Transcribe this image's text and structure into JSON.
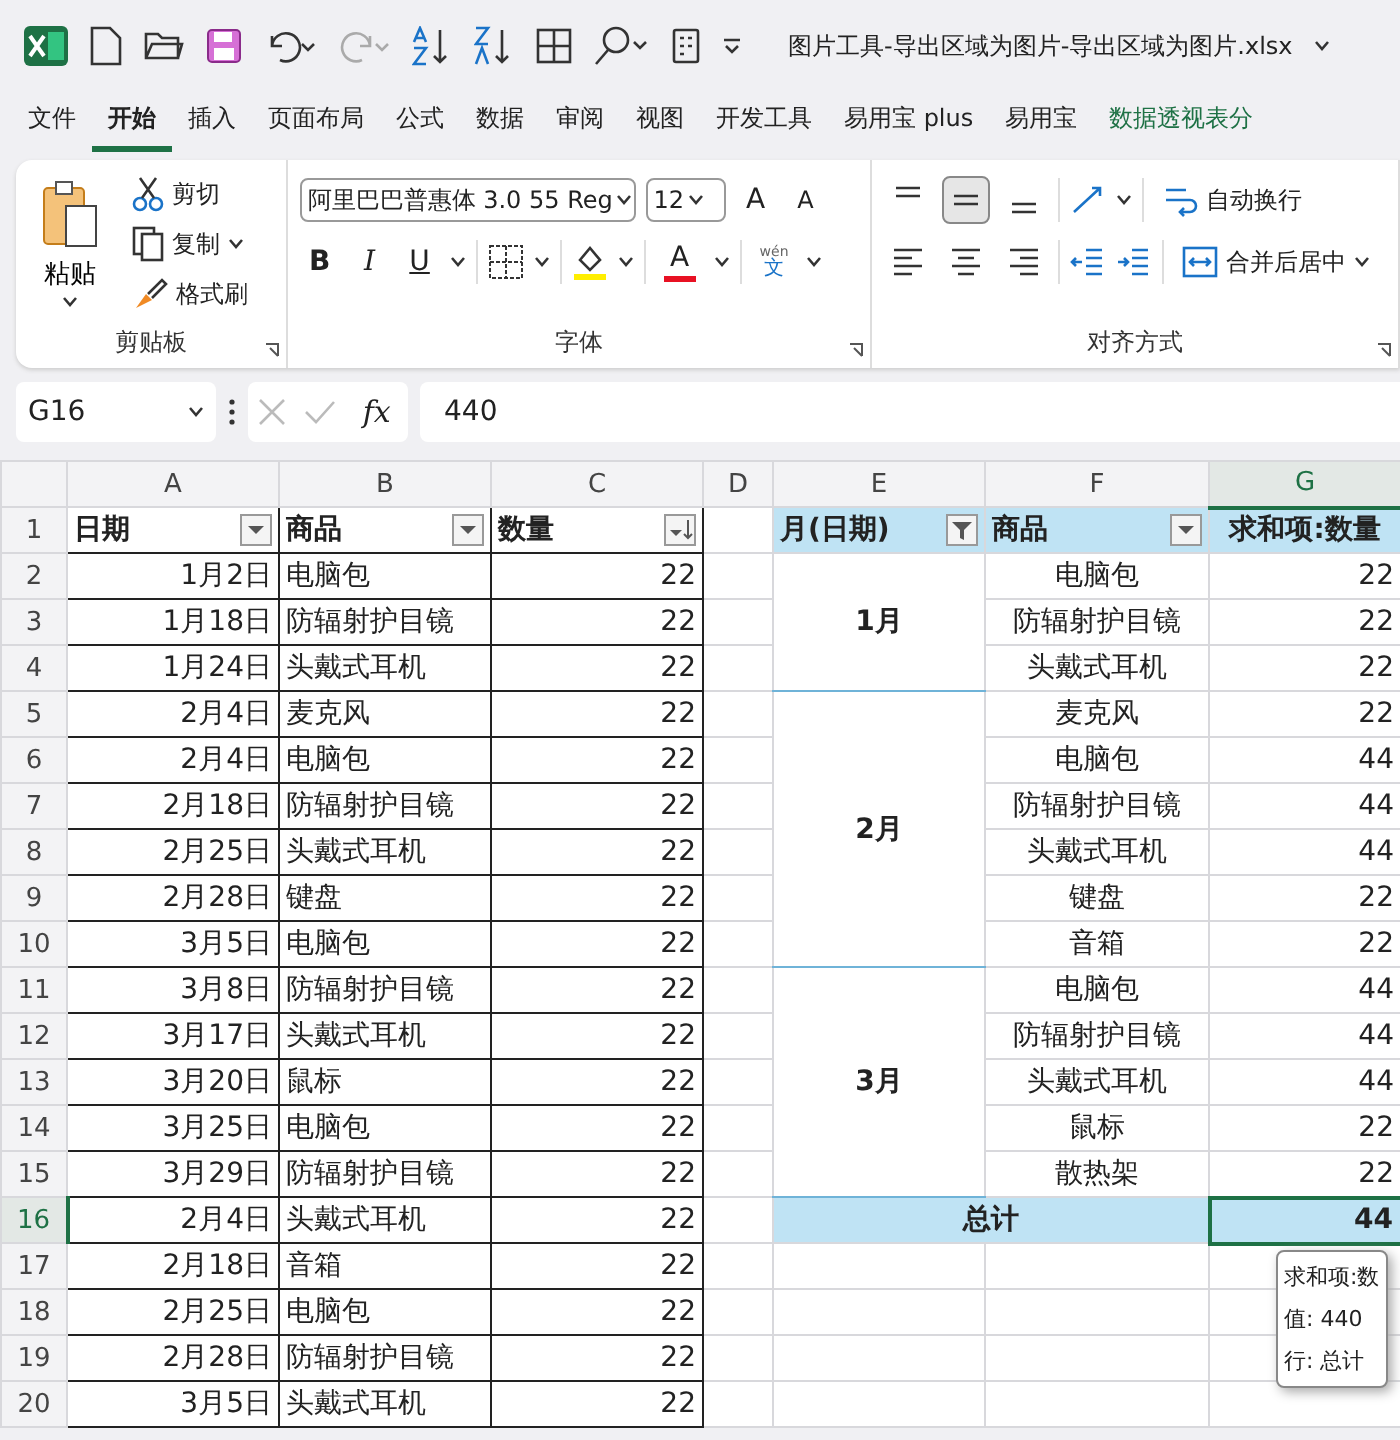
{
  "title_bar": {
    "title": "图片工具-导出区域为图片-导出区域为图片.xlsx"
  },
  "menu_tabs": [
    {
      "label": "文件",
      "selected": false,
      "contextual": false
    },
    {
      "label": "开始",
      "selected": true,
      "contextual": false
    },
    {
      "label": "插入",
      "selected": false,
      "contextual": false
    },
    {
      "label": "页面布局",
      "selected": false,
      "contextual": false
    },
    {
      "label": "公式",
      "selected": false,
      "contextual": false
    },
    {
      "label": "数据",
      "selected": false,
      "contextual": false
    },
    {
      "label": "审阅",
      "selected": false,
      "contextual": false
    },
    {
      "label": "视图",
      "selected": false,
      "contextual": false
    },
    {
      "label": "开发工具",
      "selected": false,
      "contextual": false
    },
    {
      "label": "易用宝 plus",
      "selected": false,
      "contextual": false
    },
    {
      "label": "易用宝",
      "selected": false,
      "contextual": false
    },
    {
      "label": "数据透视表分",
      "selected": false,
      "contextual": true
    }
  ],
  "ribbon": {
    "clipboard": {
      "paste": "粘贴",
      "cut": "剪切",
      "copy": "复制",
      "format_painter": "格式刷",
      "group_label": "剪贴板"
    },
    "font": {
      "font_name": "阿里巴巴普惠体 3.0 55 Reg",
      "font_size": "12",
      "grow_font": "A",
      "shrink_font": "A",
      "bold": "B",
      "italic": "I",
      "underline": "U",
      "font_color": "A",
      "phonetic_top": "wén",
      "phonetic_bottom": "文",
      "group_label": "字体"
    },
    "alignment": {
      "vertical": [
        {
          "kind": "top",
          "selected": false
        },
        {
          "kind": "middle",
          "selected": true
        },
        {
          "kind": "bottom",
          "selected": false
        }
      ],
      "horizontal": [
        {
          "kind": "left",
          "selected": false
        },
        {
          "kind": "center",
          "selected": false
        },
        {
          "kind": "right",
          "selected": false
        }
      ],
      "wrap_text": "自动换行",
      "merge_center": "合并后居中",
      "group_label": "对齐方式"
    }
  },
  "formula_bar": {
    "name_box": "G16",
    "fx": "fx",
    "formula": "440"
  },
  "sheet": {
    "columns": [
      {
        "label": "A",
        "selected": false
      },
      {
        "label": "B",
        "selected": false
      },
      {
        "label": "C",
        "selected": false
      },
      {
        "label": "D",
        "selected": false
      },
      {
        "label": "E",
        "selected": false
      },
      {
        "label": "F",
        "selected": false
      },
      {
        "label": "G",
        "selected": true
      }
    ],
    "row_numbers": [
      {
        "label": "1",
        "selected": false
      },
      {
        "label": "2",
        "selected": false
      },
      {
        "label": "3",
        "selected": false
      },
      {
        "label": "4",
        "selected": false
      },
      {
        "label": "5",
        "selected": false
      },
      {
        "label": "6",
        "selected": false
      },
      {
        "label": "7",
        "selected": false
      },
      {
        "label": "8",
        "selected": false
      },
      {
        "label": "9",
        "selected": false
      },
      {
        "label": "10",
        "selected": false
      },
      {
        "label": "11",
        "selected": false
      },
      {
        "label": "12",
        "selected": false
      },
      {
        "label": "13",
        "selected": false
      },
      {
        "label": "14",
        "selected": false
      },
      {
        "label": "15",
        "selected": false
      },
      {
        "label": "16",
        "selected": true
      },
      {
        "label": "17",
        "selected": false
      },
      {
        "label": "18",
        "selected": false
      },
      {
        "label": "19",
        "selected": false
      },
      {
        "label": "20",
        "selected": false
      }
    ],
    "source_table": {
      "headers": [
        {
          "label": "日期",
          "kind": "dropdown"
        },
        {
          "label": "商品",
          "kind": "dropdown"
        },
        {
          "label": "数量",
          "kind": "sorted"
        }
      ],
      "rows": [
        [
          "1月2日",
          "电脑包",
          "22"
        ],
        [
          "1月18日",
          "防辐射护目镜",
          "22"
        ],
        [
          "1月24日",
          "头戴式耳机",
          "22"
        ],
        [
          "2月4日",
          "麦克风",
          "22"
        ],
        [
          "2月4日",
          "电脑包",
          "22"
        ],
        [
          "2月18日",
          "防辐射护目镜",
          "22"
        ],
        [
          "2月25日",
          "头戴式耳机",
          "22"
        ],
        [
          "2月28日",
          "键盘",
          "22"
        ],
        [
          "3月5日",
          "电脑包",
          "22"
        ],
        [
          "3月8日",
          "防辐射护目镜",
          "22"
        ],
        [
          "3月17日",
          "头戴式耳机",
          "22"
        ],
        [
          "3月20日",
          "鼠标",
          "22"
        ],
        [
          "3月25日",
          "电脑包",
          "22"
        ],
        [
          "3月29日",
          "防辐射护目镜",
          "22"
        ],
        [
          "2月4日",
          "头戴式耳机",
          "22"
        ],
        [
          "2月18日",
          "音箱",
          "22"
        ],
        [
          "2月25日",
          "电脑包",
          "22"
        ],
        [
          "2月28日",
          "防辐射护目镜",
          "22"
        ],
        [
          "3月5日",
          "头戴式耳机",
          "22"
        ]
      ]
    },
    "pivot": {
      "headers": [
        {
          "label": "月(日期)",
          "kind": "filtered"
        },
        {
          "label": "商品",
          "kind": "dropdown"
        },
        {
          "label": "求和项:数量",
          "kind": "none"
        }
      ],
      "groups": [
        {
          "label": "1月",
          "items": [
            {
              "name": "电脑包",
              "value": "22"
            },
            {
              "name": "防辐射护目镜",
              "value": "22"
            },
            {
              "name": "头戴式耳机",
              "value": "22"
            }
          ]
        },
        {
          "label": "2月",
          "items": [
            {
              "name": "麦克风",
              "value": "22"
            },
            {
              "name": "电脑包",
              "value": "44"
            },
            {
              "name": "防辐射护目镜",
              "value": "44"
            },
            {
              "name": "头戴式耳机",
              "value": "44"
            },
            {
              "name": "键盘",
              "value": "22"
            },
            {
              "name": "音箱",
              "value": "22"
            }
          ]
        },
        {
          "label": "3月",
          "items": [
            {
              "name": "电脑包",
              "value": "44"
            },
            {
              "name": "防辐射护目镜",
              "value": "44"
            },
            {
              "name": "头戴式耳机",
              "value": "44"
            },
            {
              "name": "鼠标",
              "value": "22"
            },
            {
              "name": "散热架",
              "value": "22"
            }
          ]
        }
      ],
      "total": {
        "label": "总计",
        "value": "44"
      }
    },
    "tooltip": {
      "lines": [
        "求和项:数",
        "值: 440",
        "行: 总计"
      ]
    }
  }
}
